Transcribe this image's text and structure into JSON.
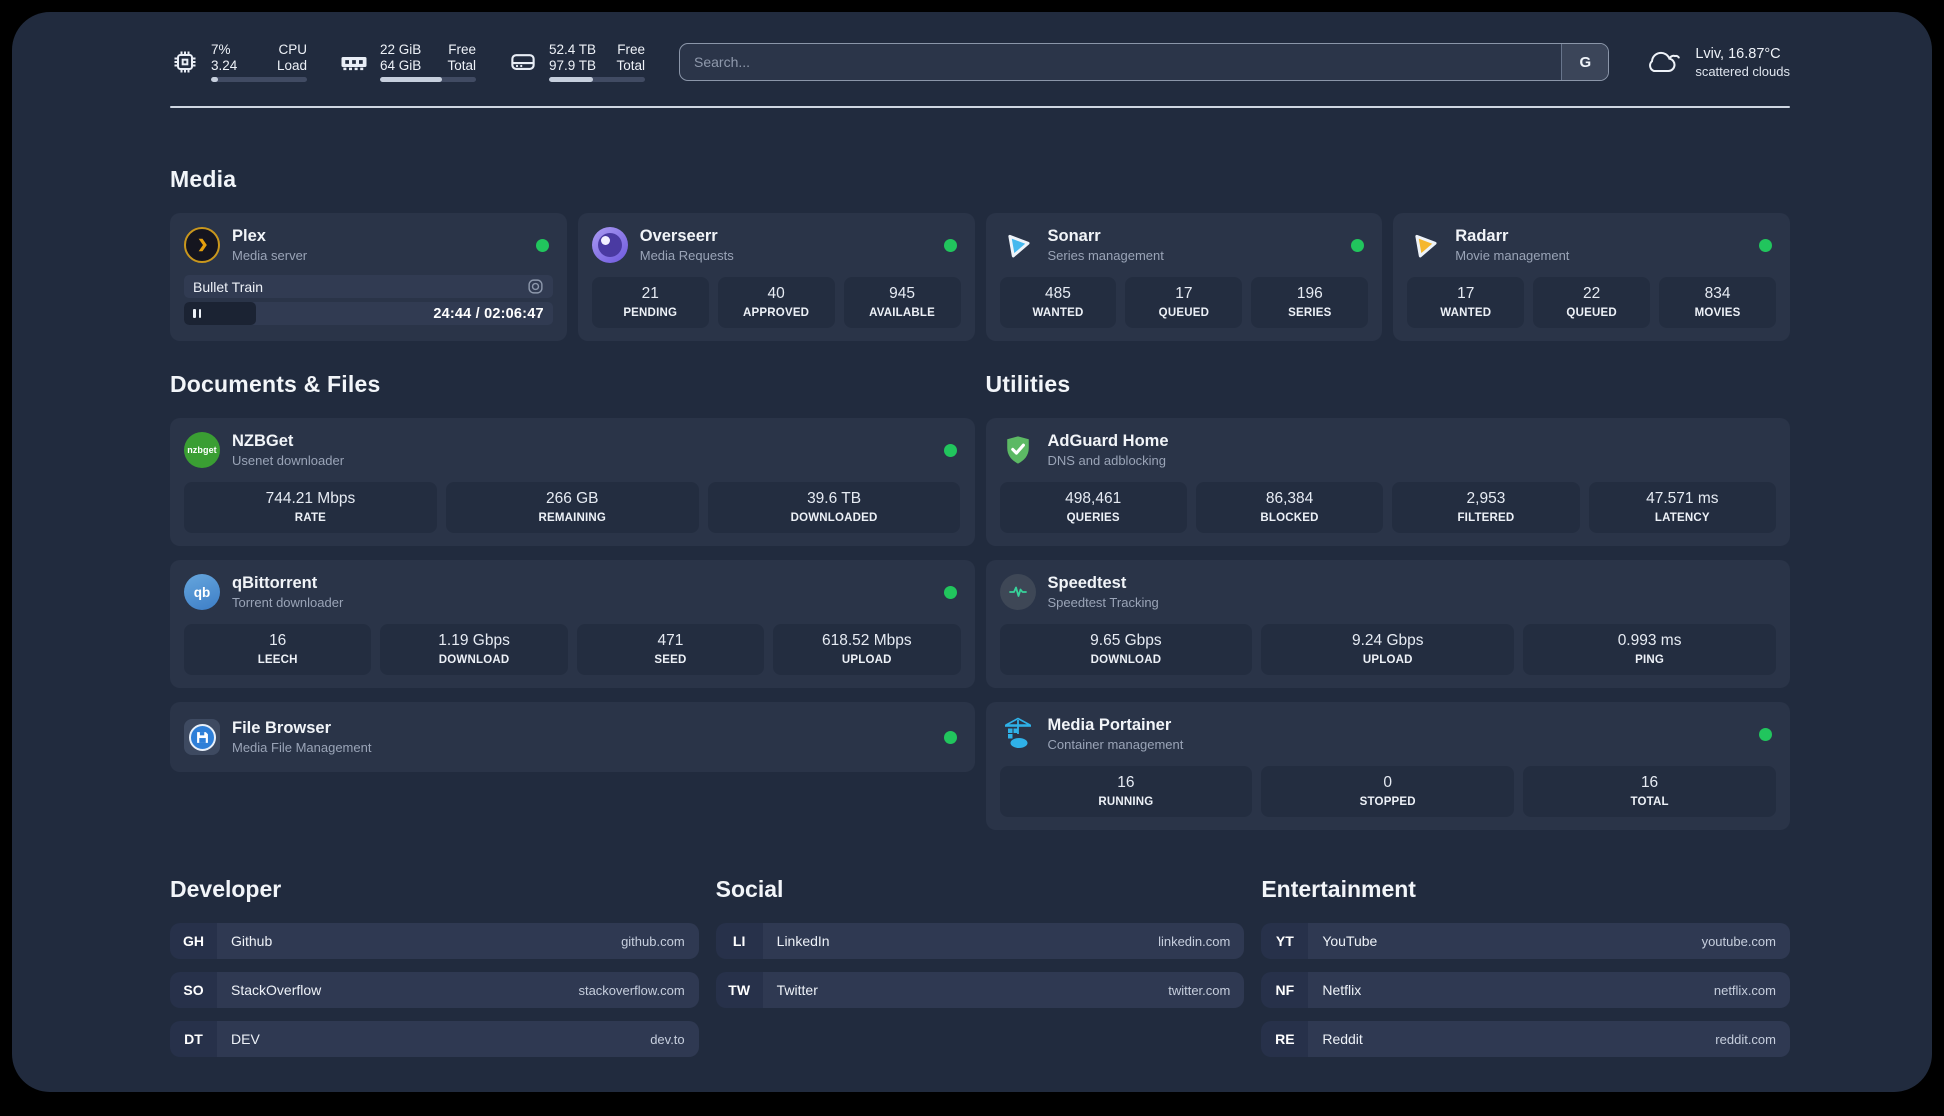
{
  "topbar": {
    "cpu": {
      "line1": "7%",
      "line2": "3.24",
      "label1": "CPU",
      "label2": "Load",
      "progress_percent": 7
    },
    "memory": {
      "line1": "22 GiB",
      "line2": "64 GiB",
      "label1": "Free",
      "label2": "Total",
      "progress_percent": 65
    },
    "disk": {
      "line1": "52.4 TB",
      "line2": "97.9 TB",
      "label1": "Free",
      "label2": "Total",
      "progress_percent": 46
    },
    "search": {
      "placeholder": "Search...",
      "engine_button": "G"
    },
    "weather": {
      "summary": "Lviv, 16.87°C",
      "condition": "scattered clouds"
    }
  },
  "media": {
    "heading": "Media",
    "plex": {
      "name": "Plex",
      "subtitle": "Media server",
      "status": "online",
      "now_playing": "Bullet Train",
      "elapsed_total": "24:44 / 02:06:47",
      "progress_percent": 19.5
    },
    "overseerr": {
      "name": "Overseerr",
      "subtitle": "Media Requests",
      "status": "online",
      "stats": [
        {
          "value": "21",
          "label": "PENDING"
        },
        {
          "value": "40",
          "label": "APPROVED"
        },
        {
          "value": "945",
          "label": "AVAILABLE"
        }
      ]
    },
    "sonarr": {
      "name": "Sonarr",
      "subtitle": "Series management",
      "status": "online",
      "stats": [
        {
          "value": "485",
          "label": "WANTED"
        },
        {
          "value": "17",
          "label": "QUEUED"
        },
        {
          "value": "196",
          "label": "SERIES"
        }
      ]
    },
    "radarr": {
      "name": "Radarr",
      "subtitle": "Movie management",
      "status": "online",
      "stats": [
        {
          "value": "17",
          "label": "WANTED"
        },
        {
          "value": "22",
          "label": "QUEUED"
        },
        {
          "value": "834",
          "label": "MOVIES"
        }
      ]
    }
  },
  "documents": {
    "heading": "Documents & Files",
    "nzbget": {
      "name": "NZBGet",
      "subtitle": "Usenet downloader",
      "status": "online",
      "logo_text": "nzbget",
      "stats": [
        {
          "value": "744.21 Mbps",
          "label": "RATE"
        },
        {
          "value": "266 GB",
          "label": "REMAINING"
        },
        {
          "value": "39.6 TB",
          "label": "DOWNLOADED"
        }
      ]
    },
    "qbittorrent": {
      "name": "qBittorrent",
      "subtitle": "Torrent downloader",
      "status": "online",
      "logo_text": "qb",
      "stats": [
        {
          "value": "16",
          "label": "LEECH"
        },
        {
          "value": "1.19 Gbps",
          "label": "DOWNLOAD"
        },
        {
          "value": "471",
          "label": "SEED"
        },
        {
          "value": "618.52 Mbps",
          "label": "UPLOAD"
        }
      ]
    },
    "filebrowser": {
      "name": "File Browser",
      "subtitle": "Media File Management",
      "status": "online"
    }
  },
  "utilities": {
    "heading": "Utilities",
    "adguard": {
      "name": "AdGuard Home",
      "subtitle": "DNS and adblocking",
      "stats": [
        {
          "value": "498,461",
          "label": "QUERIES"
        },
        {
          "value": "86,384",
          "label": "BLOCKED"
        },
        {
          "value": "2,953",
          "label": "FILTERED"
        },
        {
          "value": "47.571 ms",
          "label": "LATENCY"
        }
      ]
    },
    "speedtest": {
      "name": "Speedtest",
      "subtitle": "Speedtest Tracking",
      "stats": [
        {
          "value": "9.65 Gbps",
          "label": "DOWNLOAD"
        },
        {
          "value": "9.24 Gbps",
          "label": "UPLOAD"
        },
        {
          "value": "0.993 ms",
          "label": "PING"
        }
      ]
    },
    "portainer": {
      "name": "Media Portainer",
      "subtitle": "Container management",
      "status": "online",
      "stats": [
        {
          "value": "16",
          "label": "RUNNING"
        },
        {
          "value": "0",
          "label": "STOPPED"
        },
        {
          "value": "16",
          "label": "TOTAL"
        }
      ]
    }
  },
  "bookmarks": {
    "developer": {
      "heading": "Developer",
      "items": [
        {
          "abbr": "GH",
          "name": "Github",
          "url": "github.com"
        },
        {
          "abbr": "SO",
          "name": "StackOverflow",
          "url": "stackoverflow.com"
        },
        {
          "abbr": "DT",
          "name": "DEV",
          "url": "dev.to"
        }
      ]
    },
    "social": {
      "heading": "Social",
      "items": [
        {
          "abbr": "LI",
          "name": "LinkedIn",
          "url": "linkedin.com"
        },
        {
          "abbr": "TW",
          "name": "Twitter",
          "url": "twitter.com"
        }
      ]
    },
    "entertainment": {
      "heading": "Entertainment",
      "items": [
        {
          "abbr": "YT",
          "name": "YouTube",
          "url": "youtube.com"
        },
        {
          "abbr": "NF",
          "name": "Netflix",
          "url": "netflix.com"
        },
        {
          "abbr": "RE",
          "name": "Reddit",
          "url": "reddit.com"
        }
      ]
    }
  },
  "colors": {
    "status_online": "#21c55d",
    "page_bg": "#212b3e",
    "card_bg": "#2a3448",
    "tile_bg": "#232d40"
  }
}
